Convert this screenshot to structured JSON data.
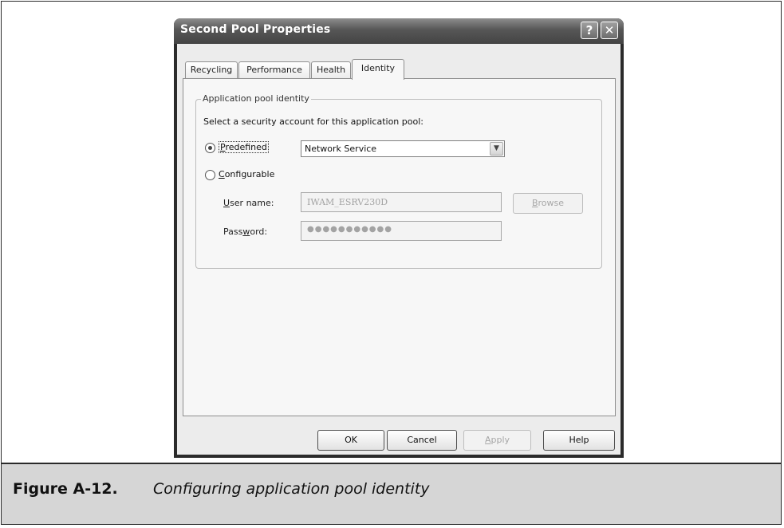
{
  "dialog": {
    "title": "Second Pool Properties",
    "title_buttons": {
      "help": "?",
      "close": "✕"
    }
  },
  "tabs": [
    {
      "label": "Recycling"
    },
    {
      "label": "Performance"
    },
    {
      "label": "Health"
    },
    {
      "label": "Identity",
      "selected": true
    }
  ],
  "group": {
    "legend": "Application pool identity",
    "instruction": "Select a security account for this application pool:"
  },
  "predefined": {
    "mnemonic": "P",
    "label_rest": "redefined",
    "selected": true,
    "dropdown_value": "Network Service"
  },
  "configurable": {
    "mnemonic": "C",
    "label_rest": "onfigurable",
    "selected": false
  },
  "user_name": {
    "mnemonic": "U",
    "label_rest": "ser name:",
    "value": "IWAM_ESRV230D"
  },
  "password": {
    "label_pre": "Pass",
    "mnemonic": "w",
    "label_post": "ord:",
    "value": "●●●●●●●●●●●"
  },
  "browse_button": {
    "mnemonic": "B",
    "label_rest": "rowse",
    "enabled": false
  },
  "footer_buttons": {
    "ok": "OK",
    "cancel": "Cancel",
    "apply_mnemonic": "A",
    "apply_rest": "pply",
    "apply_enabled": false,
    "help": "Help"
  },
  "caption": {
    "label": "Figure A-12.",
    "text": "Configuring application pool identity"
  }
}
